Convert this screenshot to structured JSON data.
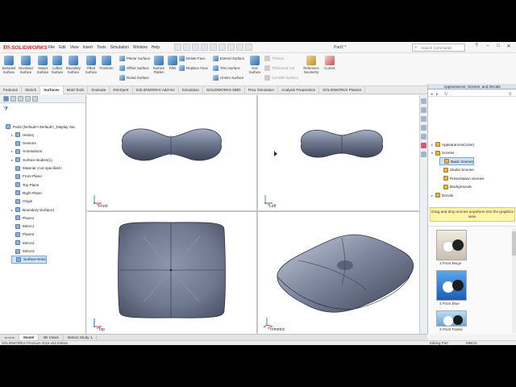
{
  "app": {
    "logo_text": "SOLIDWORKS",
    "menu": [
      "File",
      "Edit",
      "View",
      "Insert",
      "Tools",
      "Simulation",
      "Window",
      "Help"
    ],
    "document_title": "Part2 *",
    "search_placeholder": "Search Commands"
  },
  "ribbon": {
    "big_buttons": [
      {
        "label": "Extruded Surface",
        "icon": "extruded-surface-icon"
      },
      {
        "label": "Revolved Surface",
        "icon": "revolved-surface-icon"
      },
      {
        "label": "Swept Surface",
        "icon": "swept-surface-icon"
      },
      {
        "label": "Lofted Surface",
        "icon": "lofted-surface-icon"
      },
      {
        "label": "Boundary Surface",
        "icon": "boundary-surface-icon"
      },
      {
        "label": "Filled Surface",
        "icon": "filled-surface-icon"
      },
      {
        "label": "Freeform",
        "icon": "freeform-icon"
      }
    ],
    "col1": [
      "Planar Surface",
      "Offset Surface",
      "Ruled Surface"
    ],
    "surface_flatten": "Surface Flatten",
    "fillet": "Fillet",
    "col2": [
      "Delete Face",
      "Replace Face"
    ],
    "col3": [
      "Extend Surface",
      "Trim Surface",
      "Untrim Surface"
    ],
    "knit_surface": "Knit Surface",
    "col4": [
      "Thicken",
      "Thickened Cut",
      "Cut With Surface"
    ],
    "reference_geometry": "Reference Geometry",
    "curves": "Curves"
  },
  "cm_tabs": [
    "Features",
    "Sketch",
    "Surfaces",
    "Mold Tools",
    "Evaluate",
    "DimXpert",
    "SOLIDWORKS Add-Ins",
    "Simulation",
    "SOLIDWORKS MBD",
    "Flow Simulation",
    "Analysis Preparation",
    "SOLIDWORKS Plastics"
  ],
  "cm_active": "Surfaces",
  "feature_tree": [
    {
      "label": "Part2  (Default<<Default>_Display Sta",
      "icon": "part-icon",
      "expander": ""
    },
    {
      "label": "History",
      "icon": "history-icon",
      "expander": "▸"
    },
    {
      "label": "Sensors",
      "icon": "sensor-icon",
      "expander": ""
    },
    {
      "label": "Annotations",
      "icon": "annotations-icon",
      "expander": "▸"
    },
    {
      "label": "Surface Bodies(1)",
      "icon": "surface-bodies-icon",
      "expander": "▸"
    },
    {
      "label": "Material <not specified>",
      "icon": "material-icon",
      "expander": ""
    },
    {
      "label": "Front Plane",
      "icon": "plane-icon",
      "expander": ""
    },
    {
      "label": "Top Plane",
      "icon": "plane-icon",
      "expander": ""
    },
    {
      "label": "Right Plane",
      "icon": "plane-icon",
      "expander": ""
    },
    {
      "label": "Origin",
      "icon": "origin-icon",
      "expander": ""
    },
    {
      "label": "Boundary-Surface1",
      "icon": "boundary-surface-icon",
      "expander": "▸"
    },
    {
      "label": "Plane1",
      "icon": "plane-icon",
      "expander": ""
    },
    {
      "label": "Mirror1",
      "icon": "mirror-icon",
      "expander": ""
    },
    {
      "label": "Plane2",
      "icon": "plane-icon",
      "expander": ""
    },
    {
      "label": "Mirror2",
      "icon": "mirror-icon",
      "expander": ""
    },
    {
      "label": "Mirror3",
      "icon": "mirror-icon",
      "expander": ""
    },
    {
      "label": "Surface-Knit1",
      "icon": "knit-surface-icon",
      "expander": "",
      "selected": true
    }
  ],
  "viewports": {
    "front": "*Front",
    "left": "*Left",
    "top": "*Top",
    "trimetric": "*Trimetric"
  },
  "task_pane": {
    "header": "Appearances, Scenes, and Decals",
    "tree": [
      {
        "label": "Appearances(color)",
        "expander": "▸",
        "indent": 0
      },
      {
        "label": "Scenes",
        "expander": "▾",
        "indent": 0
      },
      {
        "label": "Basic Scenes",
        "expander": "",
        "indent": 1,
        "selected": true
      },
      {
        "label": "Studio Scenes",
        "expander": "",
        "indent": 1
      },
      {
        "label": "Presentation Scenes",
        "expander": "",
        "indent": 1
      },
      {
        "label": "Backgrounds",
        "expander": "",
        "indent": 1
      },
      {
        "label": "Decals",
        "expander": "▸",
        "indent": 0
      }
    ],
    "hint": "Drag and drop scenes anywhere into the graphics view.",
    "scenes": [
      "3 Point Beige",
      "3 Point Blue",
      "3 Point Faded"
    ]
  },
  "bottom_tabs": [
    "Model",
    "3D Views",
    "Motion Study 1"
  ],
  "bottom_active": "Model",
  "bottom_nav": "◂◂ ◂ ▸ ▸▸",
  "status": {
    "left": "SOLIDWORKS Premium 2016 x64 Edition",
    "mode": "Editing Part",
    "units": "MMGS"
  },
  "colors": {
    "model_fill": "#6f7990",
    "model_dark": "#3f465a",
    "model_light": "#b9c1d6",
    "accent_red": "#d52b1e",
    "selection": "#cde3fa",
    "hint_bg": "#fff5a8"
  }
}
